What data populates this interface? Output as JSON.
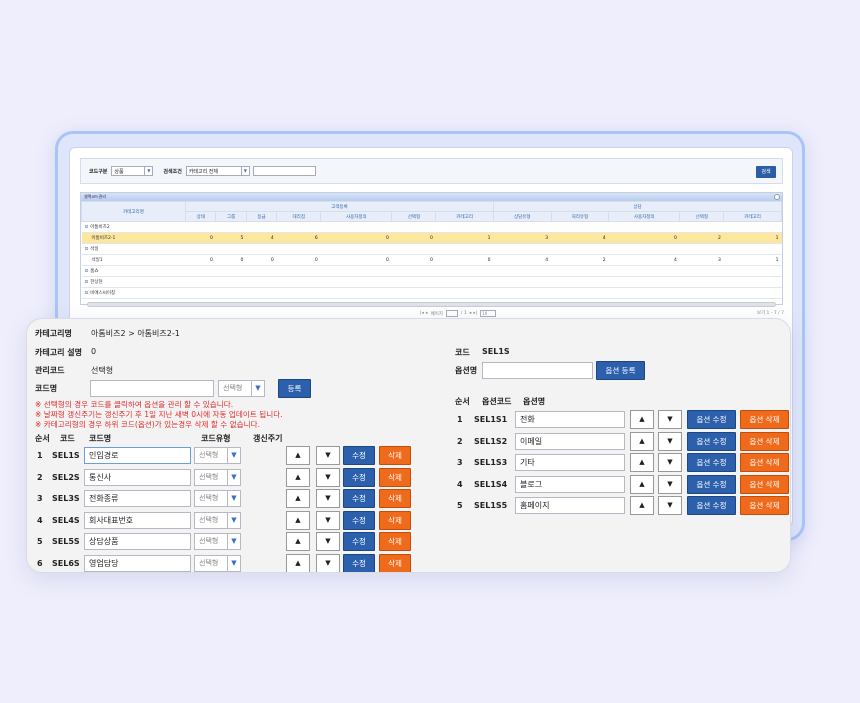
{
  "back": {
    "search": {
      "code_type_label": "코드구분",
      "code_type_value": "상품",
      "condition_label": "검색조건",
      "condition_value": "카테고리 전체",
      "search_button": "검색"
    },
    "grid": {
      "title": "셀렉코드관리",
      "col_category": "카테고리명",
      "group1": "고객등록",
      "group2": "상담",
      "columns": [
        "상태",
        "그룹",
        "등급",
        "대리점",
        "사용자정의",
        "선택형",
        "카테고리",
        "상담유형",
        "처리유형",
        "사용자정의",
        "선택형",
        "카테고리"
      ],
      "rows": [
        {
          "name": "아톰비즈2",
          "values": []
        },
        {
          "name": "아톰비즈2-1",
          "values": [
            "0",
            "5",
            "4",
            "6",
            "0",
            "0",
            "1",
            "3",
            "4",
            "0",
            "2",
            "1"
          ],
          "selected": true
        },
        {
          "name": "석일",
          "values": []
        },
        {
          "name": "석일1",
          "values": [
            "0",
            "0",
            "0",
            "0",
            "0",
            "0",
            "0",
            "4",
            "2",
            "4",
            "3",
            "1"
          ]
        },
        {
          "name": "홈쇼",
          "values": []
        },
        {
          "name": "한상현",
          "values": []
        },
        {
          "name": "비에스씨이칭",
          "values": []
        }
      ],
      "pager": {
        "prefix": "페이지",
        "of": "/ 1",
        "per_page": "10"
      },
      "view_info": "보기 1 - 7 / 7"
    }
  },
  "front": {
    "category_name_label": "카테고리명",
    "category_name_value": "아톰비즈2 > 아톰비즈2-1",
    "category_desc_label": "카테고리 설명",
    "category_desc_value": "0",
    "mgmt_code_label": "관리코드",
    "mgmt_code_value": "선택형",
    "code_name_label": "코드명",
    "code_name_input": "",
    "code_name_type": "선택형",
    "register_button": "등록",
    "notes": [
      "※ 선택형의 경우 코드를 클릭하여 옵션을 관리 할 수 있습니다.",
      "※ 날짜형 갱신주기는 갱신주기 후 1일 지난 새벽 0시에 자동 업데이트 됩니다.",
      "※ 카테고리형의 경우 하위 코드(옵션)가 있는경우 삭제 할 수 없습니다."
    ],
    "headers": {
      "order": "순서",
      "code": "코드",
      "code_name": "코드명",
      "code_type": "코드유형",
      "renew": "갱신주기"
    },
    "rows": [
      {
        "order": "1",
        "code": "SEL1S",
        "name": "인입경로",
        "type": "선택형",
        "active": true
      },
      {
        "order": "2",
        "code": "SEL2S",
        "name": "통신사",
        "type": "선택형"
      },
      {
        "order": "3",
        "code": "SEL3S",
        "name": "전화종류",
        "type": "선택형"
      },
      {
        "order": "4",
        "code": "SEL4S",
        "name": "회사대표번호",
        "type": "선택형"
      },
      {
        "order": "5",
        "code": "SEL5S",
        "name": "상담상품",
        "type": "선택형"
      },
      {
        "order": "6",
        "code": "SEL6S",
        "name": "영업담당",
        "type": "선택형"
      }
    ],
    "up": "▲",
    "down": "▼",
    "edit": "수정",
    "delete": "삭제",
    "option": {
      "code_label": "코드",
      "code_value": "SEL1S",
      "option_name_label": "옵션명",
      "option_name_input": "",
      "register_button": "옵션 등록",
      "headers": {
        "order": "순서",
        "option_code": "옵션코드",
        "option_name": "옵션명"
      },
      "rows": [
        {
          "order": "1",
          "code": "SEL1S1",
          "name": "전화"
        },
        {
          "order": "2",
          "code": "SEL1S2",
          "name": "이메일"
        },
        {
          "order": "3",
          "code": "SEL1S3",
          "name": "기타"
        },
        {
          "order": "4",
          "code": "SEL1S4",
          "name": "블로그"
        },
        {
          "order": "5",
          "code": "SEL1S5",
          "name": "홈페이지"
        }
      ],
      "edit": "옵션 수정",
      "delete": "옵션 삭제"
    }
  }
}
